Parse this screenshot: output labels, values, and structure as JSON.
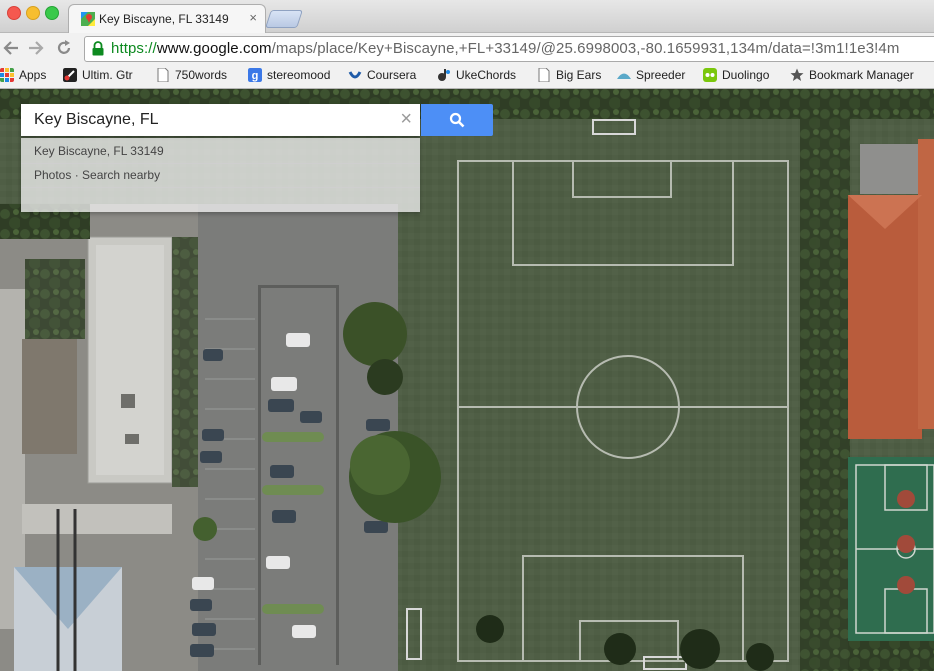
{
  "browser": {
    "tab_title": "Key Biscayne, FL 33149",
    "tab_close": "×",
    "back_icon": "back-arrow-icon",
    "forward_icon": "forward-arrow-icon",
    "reload_icon": "reload-icon",
    "url_scheme": "https://",
    "url_domain": "www.google.com",
    "url_path": "/maps/place/Key+Biscayne,+FL+33149/@25.6998003,-80.1659931,134m/data=!3m1!1e3!4m"
  },
  "bookmarks": [
    {
      "label": "Apps",
      "icon": "apps-grid-icon"
    },
    {
      "label": "Ultim. Gtr",
      "icon": "guitar-icon"
    },
    {
      "label": "750words",
      "icon": "page-icon"
    },
    {
      "label": "stereomood",
      "icon": "google-g-icon"
    },
    {
      "label": "Coursera",
      "icon": "coursera-icon"
    },
    {
      "label": "UkeChords",
      "icon": "ukechords-icon"
    },
    {
      "label": "Big Ears",
      "icon": "page-icon"
    },
    {
      "label": "Spreeder",
      "icon": "spreeder-icon"
    },
    {
      "label": "Duolingo",
      "icon": "duolingo-icon"
    },
    {
      "label": "Bookmark Manager",
      "icon": "star-icon"
    }
  ],
  "search": {
    "value": "Key Biscayne, FL",
    "clear_icon": "×",
    "button_icon": "search-icon",
    "suggestions": [
      "Key Biscayne, FL 33149",
      "Photos · Search nearby"
    ]
  },
  "colors": {
    "search_button": "#4d8ff6",
    "grass": "#4f5e45",
    "url_secure": "#0d8a20"
  }
}
